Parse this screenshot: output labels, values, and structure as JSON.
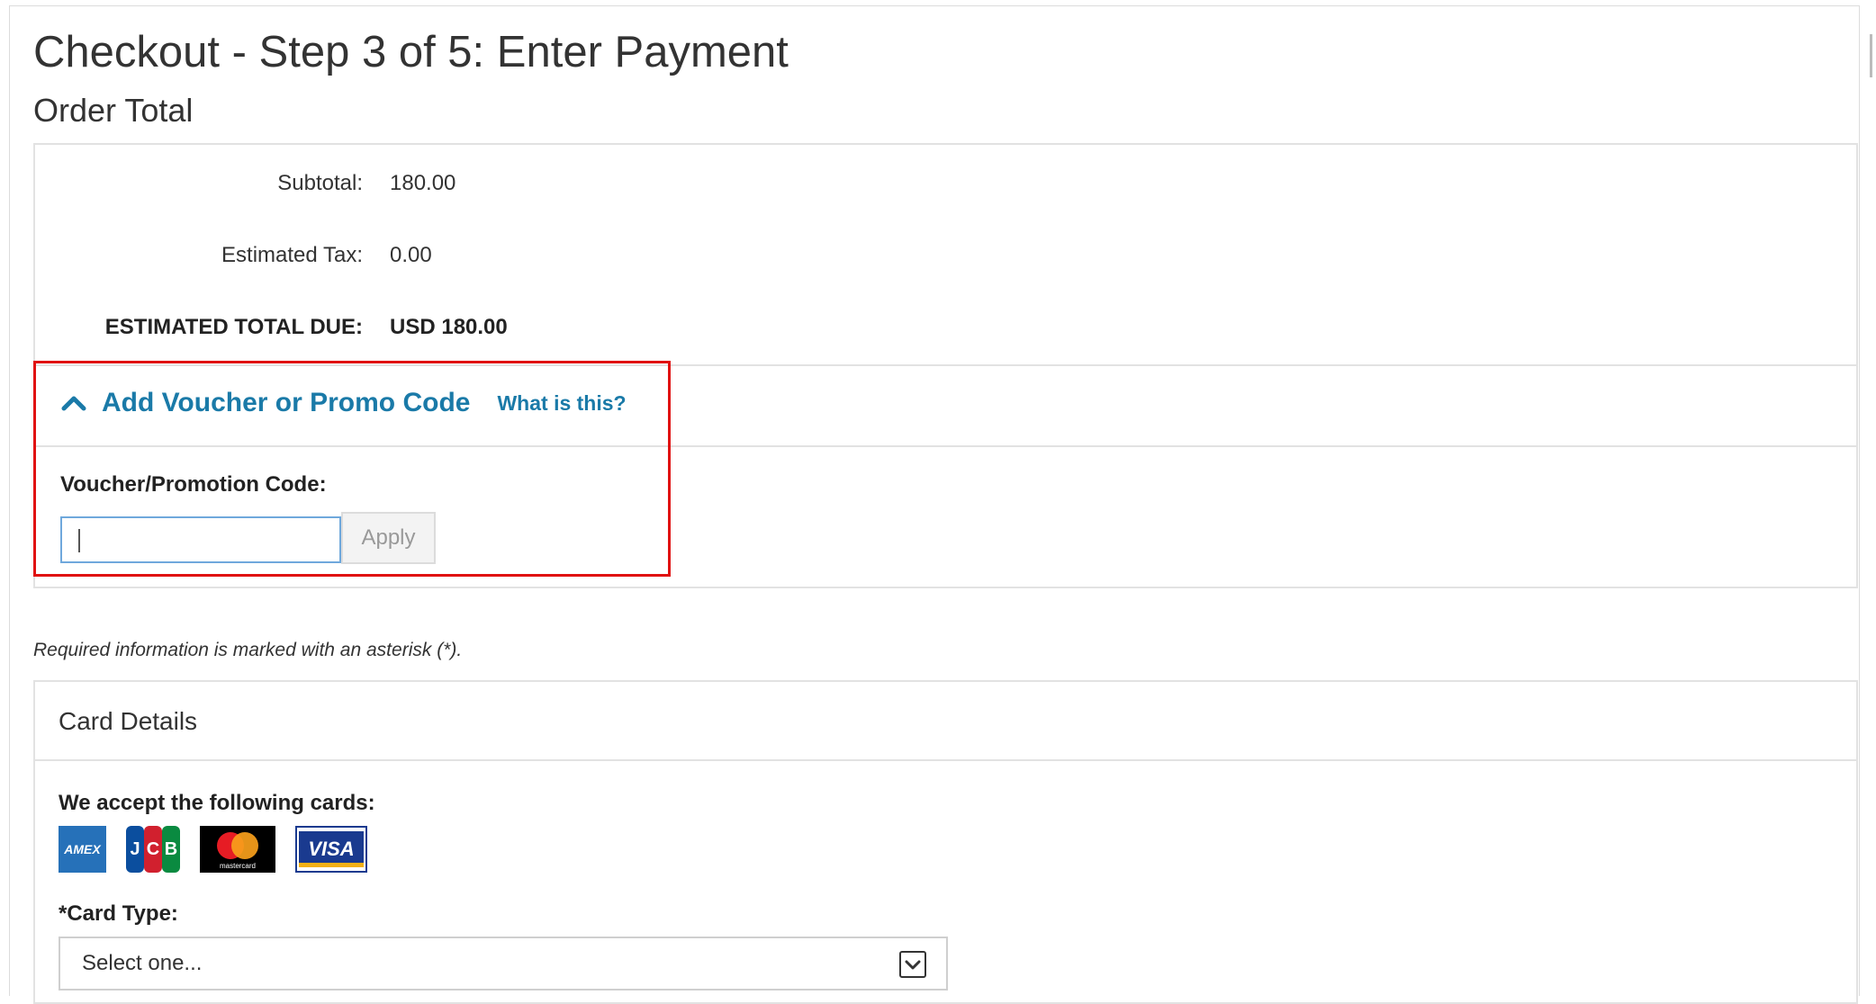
{
  "page": {
    "title": "Checkout - Step 3 of 5: Enter Payment",
    "order_heading": "Order Total"
  },
  "order_total": {
    "rows": [
      {
        "label": "Subtotal:",
        "value": "180.00"
      },
      {
        "label": "Estimated Tax:",
        "value": "0.00"
      },
      {
        "label": "ESTIMATED TOTAL DUE:",
        "value": "USD 180.00"
      }
    ]
  },
  "voucher": {
    "toggle_label": "Add Voucher or Promo Code",
    "help_link": "What is this?",
    "field_label": "Voucher/Promotion Code:",
    "input_value": "",
    "apply_label": "Apply",
    "icon": "chevron-up-icon",
    "link_color": "#1a7aa8",
    "highlight_color": "#e01010"
  },
  "required_note": "Required information is marked with an asterisk (*).",
  "card_details": {
    "header": "Card Details",
    "accept_label": "We accept the following cards:",
    "cards": [
      {
        "name": "amex-logo",
        "text": "AMEX"
      },
      {
        "name": "jcb-logo",
        "text": "JCB"
      },
      {
        "name": "mastercard-logo",
        "text": "mastercard"
      },
      {
        "name": "visa-logo",
        "text": "VISA"
      }
    ],
    "card_type_label": "*Card Type:",
    "card_type_selected": "Select one...",
    "dropdown_icon": "chevron-down-icon"
  }
}
